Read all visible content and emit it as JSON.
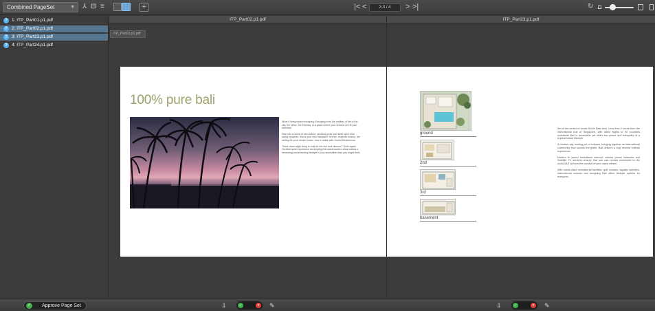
{
  "toolbar": {
    "pageset_selected": "Combined PageSet",
    "page_indicator": "2-3 / 4"
  },
  "sidebar": {
    "files": [
      {
        "label": "1: ITP_Part01.p1.pdf",
        "selected": false
      },
      {
        "label": "2: ITP_Part02.p1.pdf",
        "selected": true
      },
      {
        "label": "3: ITP_Part23.p1.pdf",
        "selected": true
      },
      {
        "label": "4: ITP_Part24.p1.pdf",
        "selected": false
      }
    ],
    "approve_label": "Approve Page Set"
  },
  "columns": {
    "left_title": "ITP_Part02.p1.pdf",
    "right_title": "ITP_Part23.p1.pdf"
  },
  "tooltip": "ITP_Part23.p1.pdf",
  "left_page": {
    "title": "100% pure bali",
    "paragraphs": [
      "What if living meant escaping. Escaping from the realities of life in the city, the office, the freeway, to a place where your dreams are at your doorstep.",
      "Step into a world of rich culture, amazing color and wide open blue sandy beaches, this is your new backyard. Serene, majestic beauty, the setting for your dream house, now a reality with Orchid Residences.",
      "There resort style living is only for the rich and famous? Think again. Orchid's local experience developing first class modern villas means a rewarding and enriching lifestyle is now accessible than you might think."
    ]
  },
  "right_page": {
    "plans": [
      {
        "label": "ground"
      },
      {
        "label": "2nd"
      },
      {
        "label": "3rd"
      },
      {
        "label": "basement"
      }
    ],
    "paragraphs": [
      "Set in the center of exotic South East Asia. Less than 2 hours from the international hub of Singapore, with direct flights to 90 countries worldwide Bali is accessible yet offers the peace and tranquility of a tropical island lifestyle.",
      "A modern day melting pot of cultures, bringing together an international community from across the globe, Bali delivers a truly diverse cultural experience.",
      "Modern hi speed broadband internet, cellular phone networks and Satellite TV services ensure that you can remain connected to the world 24/7 all from the comfort of your oasis retreat.",
      "With world-class recreational facilities, golf courses, aquatic activities, international schools and shopping Bali offers lifestyle options for everyone."
    ]
  },
  "colors": {
    "accent_blue": "#5ab0f0",
    "title_olive": "#9ea06a",
    "approve_green": "#45b04a",
    "reject_red": "#e23b3b"
  }
}
